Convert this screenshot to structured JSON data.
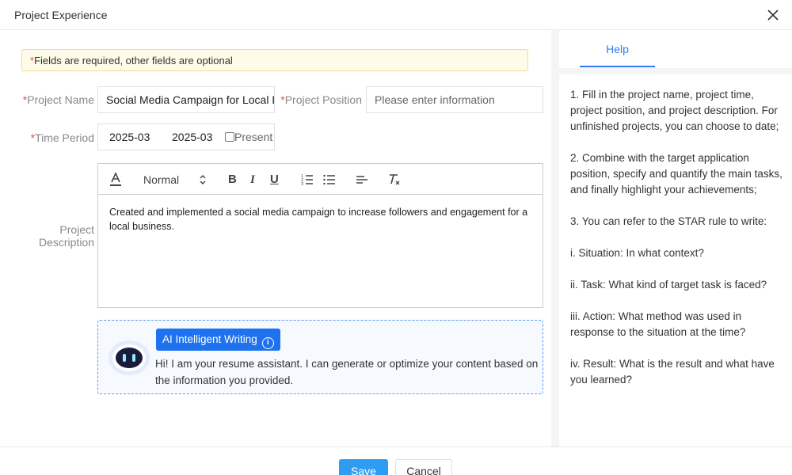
{
  "dialog": {
    "title": "Project Experience"
  },
  "form": {
    "notice": "Fields are required, other fields are optional",
    "required_mark": "*",
    "project_name": {
      "label": "Project Name",
      "value": "Social Media Campaign for Local Bu"
    },
    "project_position": {
      "label": "Project Position",
      "placeholder": "Please enter information"
    },
    "time_period": {
      "label": "Time Period",
      "start": "2025-03",
      "end": "2025-03",
      "present_label": "Present",
      "present_checked": false
    },
    "project_description": {
      "label_line1": "Project",
      "label_line2": "Description",
      "format_select": "Normal",
      "content": "Created and implemented a social media campaign to increase followers and engagement for a local business."
    }
  },
  "ai": {
    "badge_label": "AI Intelligent Writing",
    "info_glyph": "i",
    "message": "Hi! I am your resume assistant. I can generate or optimize your content based on the information you provided."
  },
  "help": {
    "tab_label": "Help",
    "paragraphs": [
      "1. Fill in the project name, project time, project position, and project description. For unfinished projects, you can choose to date;",
      "2. Combine with the target application position, specify and quantify the main tasks, and finally highlight your achievements;",
      "3. You can refer to the STAR rule to write:",
      "i. Situation: In what context?",
      "ii. Task: What kind of target task is faced?",
      "iii. Action: What method was used in response to the situation at the time?",
      "iv. Result: What is the result and what have you learned?"
    ]
  },
  "footer": {
    "save_label": "Save",
    "cancel_label": "Cancel"
  },
  "colors": {
    "accent": "#2f7cf6",
    "save_button": "#2f9cf4",
    "ai_badge": "#1f72ef",
    "required": "#e74c3c",
    "notice_bg": "#fefbe8"
  },
  "icons": {
    "close": "close-icon",
    "text_color": "text-color-icon",
    "select_arrows": "select-arrows-icon",
    "bold": "bold-icon",
    "italic": "italic-icon",
    "underline": "underline-icon",
    "ordered_list": "ordered-list-icon",
    "bullet_list": "bullet-list-icon",
    "align": "align-left-icon",
    "clear_format": "clear-format-icon",
    "robot": "robot-avatar-icon",
    "info": "info-icon"
  }
}
